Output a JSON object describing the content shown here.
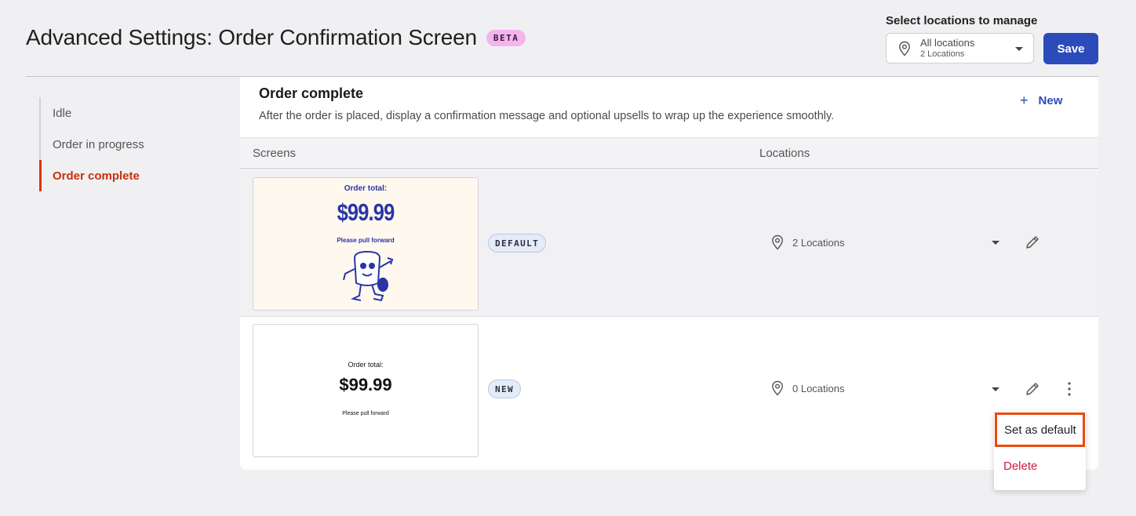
{
  "header": {
    "title": "Advanced Settings: Order Confirmation Screen",
    "beta_badge": "BETA",
    "location_label": "Select locations to manage",
    "location_select": {
      "value": "All locations",
      "sub": "2 Locations"
    },
    "save_label": "Save"
  },
  "sidebar": {
    "items": [
      {
        "label": "Idle",
        "active": false
      },
      {
        "label": "Order in progress",
        "active": false
      },
      {
        "label": "Order complete",
        "active": true
      }
    ]
  },
  "section": {
    "title": "Order complete",
    "description": "After the order is placed, display a confirmation message and optional upsells to wrap up the experience smoothly.",
    "new_label": "New"
  },
  "table": {
    "columns": [
      "Screens",
      "Locations"
    ],
    "rows": [
      {
        "thumb": {
          "label": "Order total:",
          "price": "$99.99",
          "pull": "Please pull forward"
        },
        "badge": "DEFAULT",
        "locations": "2 Locations"
      },
      {
        "thumb": {
          "label": "Order total:",
          "price": "$99.99",
          "pull": "Please pull forward"
        },
        "badge": "NEW",
        "locations": "0 Locations"
      }
    ]
  },
  "context_menu": {
    "set_default": "Set as default",
    "delete": "Delete"
  },
  "colors": {
    "accent": "#2c4bba",
    "active_nav": "#c8300a",
    "highlight": "#ea4a0c",
    "danger": "#c8203a"
  }
}
